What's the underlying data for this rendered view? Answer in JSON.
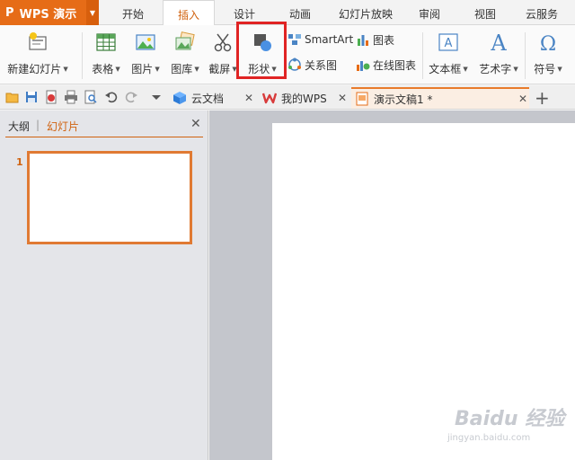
{
  "app": {
    "logo_letter": "P",
    "title": "WPS 演示"
  },
  "menu_tabs": [
    "开始",
    "插入",
    "设计",
    "动画",
    "幻灯片放映",
    "审阅",
    "视图",
    "云服务"
  ],
  "active_menu_tab": "插入",
  "ribbon": {
    "new_slide": "新建幻灯片",
    "table": "表格",
    "picture": "图片",
    "gallery": "图库",
    "screenshot": "截屏",
    "shape": "形状",
    "smartart": "SmartArt",
    "chart": "图表",
    "relation": "关系图",
    "online_chart": "在线图表",
    "textbox": "文本框",
    "wordart": "艺术字",
    "symbol": "符号"
  },
  "doc_tabs": [
    {
      "label": "云文档",
      "active": false
    },
    {
      "label": "我的WPS",
      "active": false
    },
    {
      "label": "演示文稿1 *",
      "active": true
    }
  ],
  "panel": {
    "outline_tab": "大纲",
    "separator": "|",
    "slides_tab": "幻灯片",
    "slide_number": "1"
  },
  "watermark": {
    "brand": "Baidu 经验",
    "url": "jingyan.baidu.com"
  },
  "colors": {
    "accent": "#e66c17",
    "highlight": "#e02424"
  }
}
